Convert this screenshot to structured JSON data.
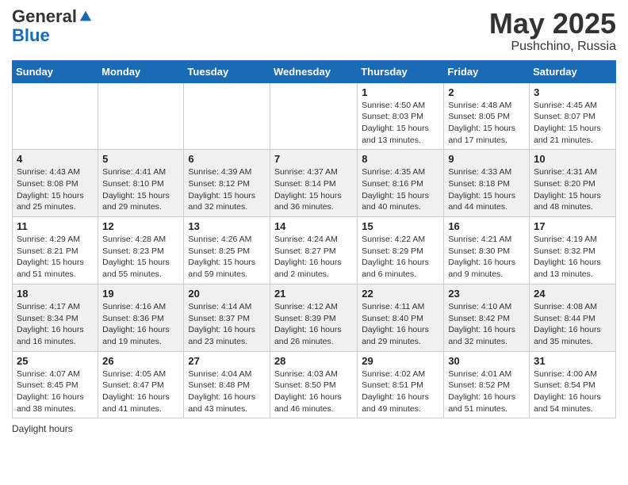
{
  "logo": {
    "general": "General",
    "blue": "Blue"
  },
  "title": "May 2025",
  "location": "Pushchino, Russia",
  "days_of_week": [
    "Sunday",
    "Monday",
    "Tuesday",
    "Wednesday",
    "Thursday",
    "Friday",
    "Saturday"
  ],
  "footer": "Daylight hours",
  "weeks": [
    [
      {
        "day": "",
        "info": ""
      },
      {
        "day": "",
        "info": ""
      },
      {
        "day": "",
        "info": ""
      },
      {
        "day": "",
        "info": ""
      },
      {
        "day": "1",
        "sunrise": "4:50 AM",
        "sunset": "8:03 PM",
        "daylight": "15 hours and 13 minutes."
      },
      {
        "day": "2",
        "sunrise": "4:48 AM",
        "sunset": "8:05 PM",
        "daylight": "15 hours and 17 minutes."
      },
      {
        "day": "3",
        "sunrise": "4:45 AM",
        "sunset": "8:07 PM",
        "daylight": "15 hours and 21 minutes."
      }
    ],
    [
      {
        "day": "4",
        "sunrise": "4:43 AM",
        "sunset": "8:08 PM",
        "daylight": "15 hours and 25 minutes."
      },
      {
        "day": "5",
        "sunrise": "4:41 AM",
        "sunset": "8:10 PM",
        "daylight": "15 hours and 29 minutes."
      },
      {
        "day": "6",
        "sunrise": "4:39 AM",
        "sunset": "8:12 PM",
        "daylight": "15 hours and 32 minutes."
      },
      {
        "day": "7",
        "sunrise": "4:37 AM",
        "sunset": "8:14 PM",
        "daylight": "15 hours and 36 minutes."
      },
      {
        "day": "8",
        "sunrise": "4:35 AM",
        "sunset": "8:16 PM",
        "daylight": "15 hours and 40 minutes."
      },
      {
        "day": "9",
        "sunrise": "4:33 AM",
        "sunset": "8:18 PM",
        "daylight": "15 hours and 44 minutes."
      },
      {
        "day": "10",
        "sunrise": "4:31 AM",
        "sunset": "8:20 PM",
        "daylight": "15 hours and 48 minutes."
      }
    ],
    [
      {
        "day": "11",
        "sunrise": "4:29 AM",
        "sunset": "8:21 PM",
        "daylight": "15 hours and 51 minutes."
      },
      {
        "day": "12",
        "sunrise": "4:28 AM",
        "sunset": "8:23 PM",
        "daylight": "15 hours and 55 minutes."
      },
      {
        "day": "13",
        "sunrise": "4:26 AM",
        "sunset": "8:25 PM",
        "daylight": "15 hours and 59 minutes."
      },
      {
        "day": "14",
        "sunrise": "4:24 AM",
        "sunset": "8:27 PM",
        "daylight": "16 hours and 2 minutes."
      },
      {
        "day": "15",
        "sunrise": "4:22 AM",
        "sunset": "8:29 PM",
        "daylight": "16 hours and 6 minutes."
      },
      {
        "day": "16",
        "sunrise": "4:21 AM",
        "sunset": "8:30 PM",
        "daylight": "16 hours and 9 minutes."
      },
      {
        "day": "17",
        "sunrise": "4:19 AM",
        "sunset": "8:32 PM",
        "daylight": "16 hours and 13 minutes."
      }
    ],
    [
      {
        "day": "18",
        "sunrise": "4:17 AM",
        "sunset": "8:34 PM",
        "daylight": "16 hours and 16 minutes."
      },
      {
        "day": "19",
        "sunrise": "4:16 AM",
        "sunset": "8:36 PM",
        "daylight": "16 hours and 19 minutes."
      },
      {
        "day": "20",
        "sunrise": "4:14 AM",
        "sunset": "8:37 PM",
        "daylight": "16 hours and 23 minutes."
      },
      {
        "day": "21",
        "sunrise": "4:12 AM",
        "sunset": "8:39 PM",
        "daylight": "16 hours and 26 minutes."
      },
      {
        "day": "22",
        "sunrise": "4:11 AM",
        "sunset": "8:40 PM",
        "daylight": "16 hours and 29 minutes."
      },
      {
        "day": "23",
        "sunrise": "4:10 AM",
        "sunset": "8:42 PM",
        "daylight": "16 hours and 32 minutes."
      },
      {
        "day": "24",
        "sunrise": "4:08 AM",
        "sunset": "8:44 PM",
        "daylight": "16 hours and 35 minutes."
      }
    ],
    [
      {
        "day": "25",
        "sunrise": "4:07 AM",
        "sunset": "8:45 PM",
        "daylight": "16 hours and 38 minutes."
      },
      {
        "day": "26",
        "sunrise": "4:05 AM",
        "sunset": "8:47 PM",
        "daylight": "16 hours and 41 minutes."
      },
      {
        "day": "27",
        "sunrise": "4:04 AM",
        "sunset": "8:48 PM",
        "daylight": "16 hours and 43 minutes."
      },
      {
        "day": "28",
        "sunrise": "4:03 AM",
        "sunset": "8:50 PM",
        "daylight": "16 hours and 46 minutes."
      },
      {
        "day": "29",
        "sunrise": "4:02 AM",
        "sunset": "8:51 PM",
        "daylight": "16 hours and 49 minutes."
      },
      {
        "day": "30",
        "sunrise": "4:01 AM",
        "sunset": "8:52 PM",
        "daylight": "16 hours and 51 minutes."
      },
      {
        "day": "31",
        "sunrise": "4:00 AM",
        "sunset": "8:54 PM",
        "daylight": "16 hours and 54 minutes."
      }
    ]
  ]
}
